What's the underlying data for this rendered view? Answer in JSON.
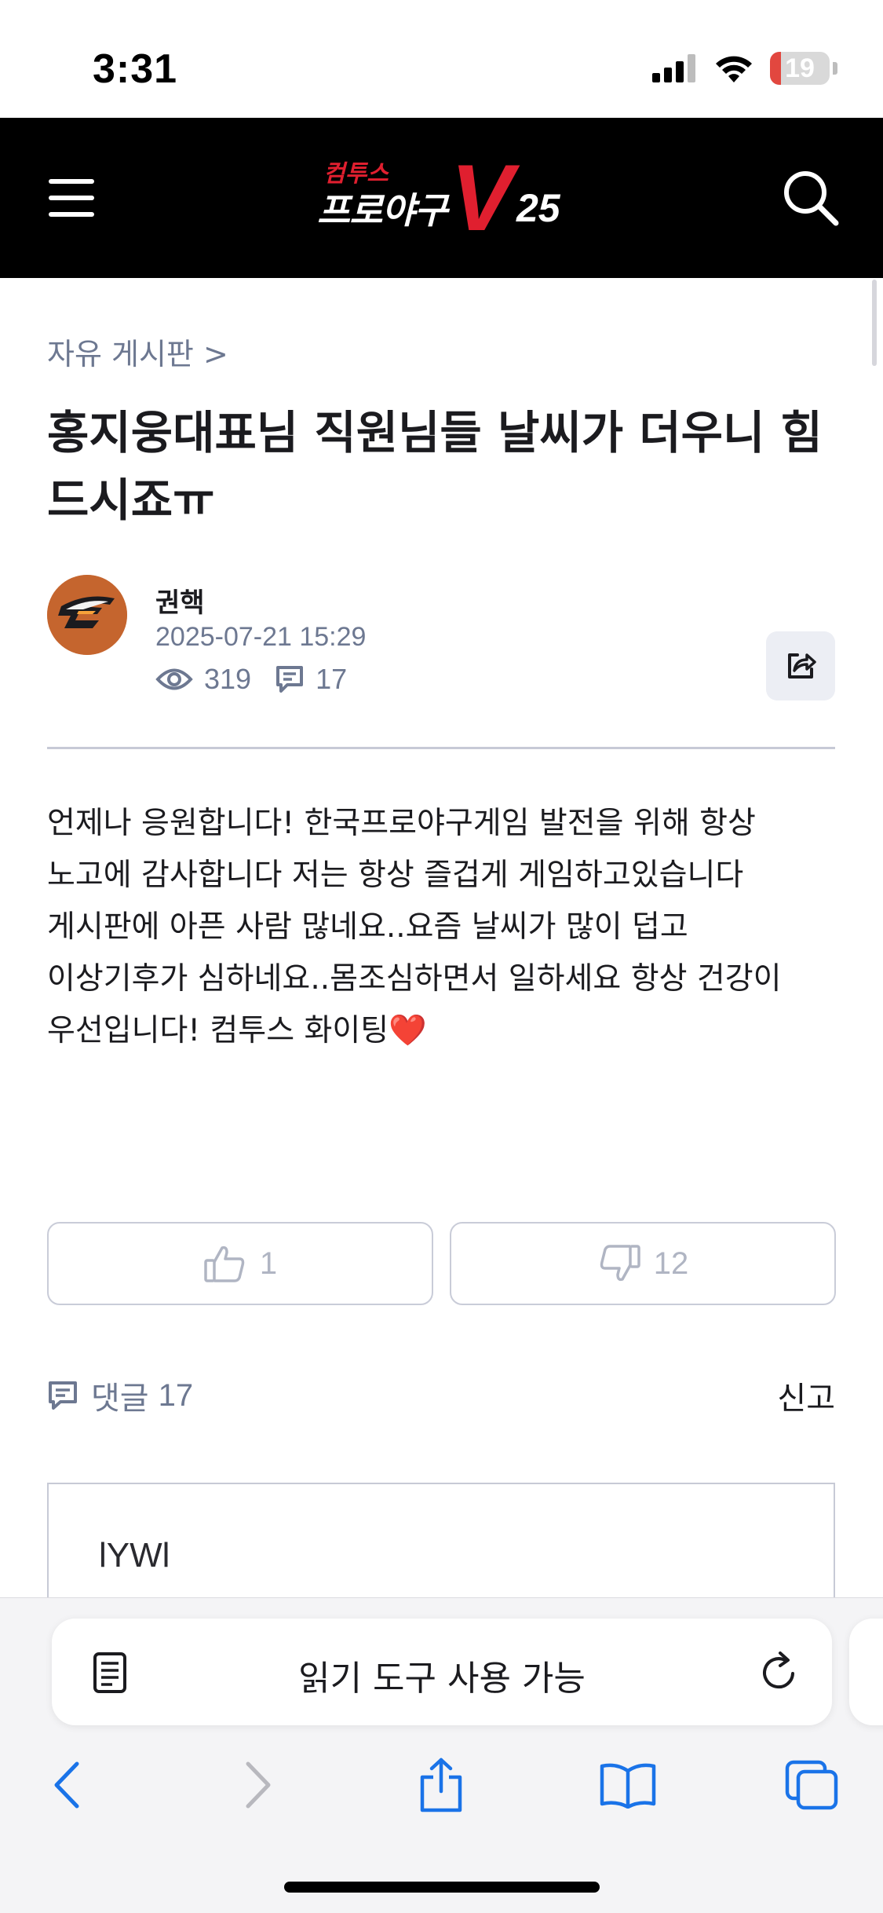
{
  "status_bar": {
    "time": "3:31",
    "battery": "19",
    "battery_level": 0.19
  },
  "header": {
    "logo_small": "컴투스",
    "logo_main": "프로야구",
    "logo_v": "V",
    "logo_num": "25",
    "menu_icon": "hamburger-icon",
    "search_icon": "search-icon"
  },
  "post": {
    "breadcrumb": "자유 게시판 >",
    "title": "홍지웅대표님 직원님들 날씨가 더우니 힘드시죠ㅠ",
    "author": "권핵",
    "date": "2025-07-21 15:29",
    "views": "319",
    "comments": "17",
    "body_lines": [
      "언제나 응원합니다! 한국프로야구게임 발전을 위해 항상",
      "노고에 감사합니다 저는 항상 즐겁게 게임하고있습니다",
      "게시판에 아픈 사람 많네요..요즘 날씨가 많이 덥고",
      "이상기후가 심하네요..몸조심하면서 일하세요 항상 건강이",
      "우선입니다! 컴투스 화이팅❤️"
    ],
    "likes": "1",
    "dislikes": "12"
  },
  "comments_section": {
    "label": "댓글",
    "count": "17",
    "report": "신고",
    "input_text": "lYWl"
  },
  "browser": {
    "address_text": "읽기 도구 사용 가능"
  },
  "colors": {
    "header_bg": "#000000",
    "brand_red": "#e01f2f",
    "meta_gray": "#6d7891",
    "avatar_orange": "#c5652e",
    "ios_blue": "#1a73e8"
  }
}
